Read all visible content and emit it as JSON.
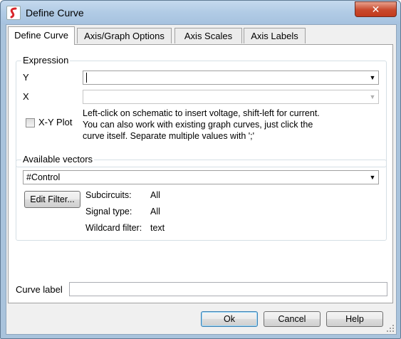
{
  "window": {
    "title": "Define Curve",
    "close_label": "✕",
    "app_icon": "simetrix-logo-icon"
  },
  "tabs": [
    {
      "label": "Define Curve",
      "active": true
    },
    {
      "label": "Axis/Graph Options",
      "active": false
    },
    {
      "label": "Axis Scales",
      "active": false
    },
    {
      "label": "Axis Labels",
      "active": false
    }
  ],
  "expression": {
    "group_label": "Expression",
    "y_label": "Y",
    "y_value": "",
    "x_label": "X",
    "x_value": "",
    "xy_plot_label": "X-Y Plot",
    "xy_plot_checked": false,
    "hint": "Left-click on schematic to insert voltage, shift-left for current. You can also work with existing graph curves, just click the curve itself. Separate multiple values with ';'"
  },
  "vectors": {
    "group_label": "Available vectors",
    "selected": "#Control",
    "edit_filter_label": "Edit Filter...",
    "subcircuits_label": "Subcircuits:",
    "subcircuits_value": "All",
    "signal_type_label": "Signal type:",
    "signal_type_value": "All",
    "wildcard_label": "Wildcard filter:",
    "wildcard_value": "text"
  },
  "curve_label": {
    "label": "Curve label",
    "value": ""
  },
  "buttons": {
    "ok": "Ok",
    "cancel": "Cancel",
    "help": "Help"
  },
  "colors": {
    "frame": "#a9c3dc",
    "close": "#c8492c",
    "logo": "#d8262b"
  }
}
